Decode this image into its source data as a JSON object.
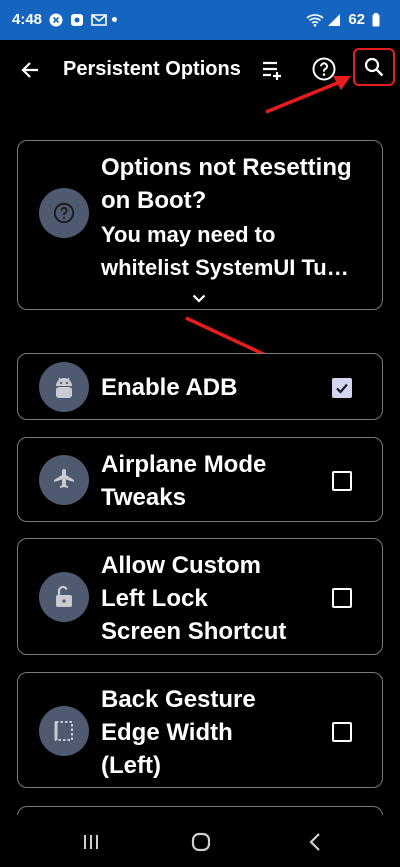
{
  "status_bar": {
    "time": "4:48",
    "battery": "62",
    "bg_color": "#1565c0"
  },
  "header": {
    "title": "Persistent Options",
    "icons": [
      "back-arrow-icon",
      "playlist-add-icon",
      "help-icon",
      "search-icon"
    ]
  },
  "info_card": {
    "title_line": "Options not Resetting\non Boot?",
    "body": "You may need to\nwhitelist SystemUI Tu…",
    "icon": "question-icon"
  },
  "options": [
    {
      "label": "Enable ADB",
      "checked": true,
      "icon": "android-icon"
    },
    {
      "label": "Airplane Mode\nTweaks",
      "checked": false,
      "icon": "airplane-icon"
    },
    {
      "label": "Allow Custom\nLeft Lock\nScreen Shortcut",
      "checked": false,
      "icon": "lock-open-icon"
    },
    {
      "label": "Back Gesture\nEdge Width\n(Left)",
      "checked": false,
      "icon": "edge-width-icon"
    }
  ],
  "colors": {
    "accent_bg": "#4f5a71",
    "annotation": "#e81c1c",
    "checkbox_checked": "#d4d6f0"
  }
}
